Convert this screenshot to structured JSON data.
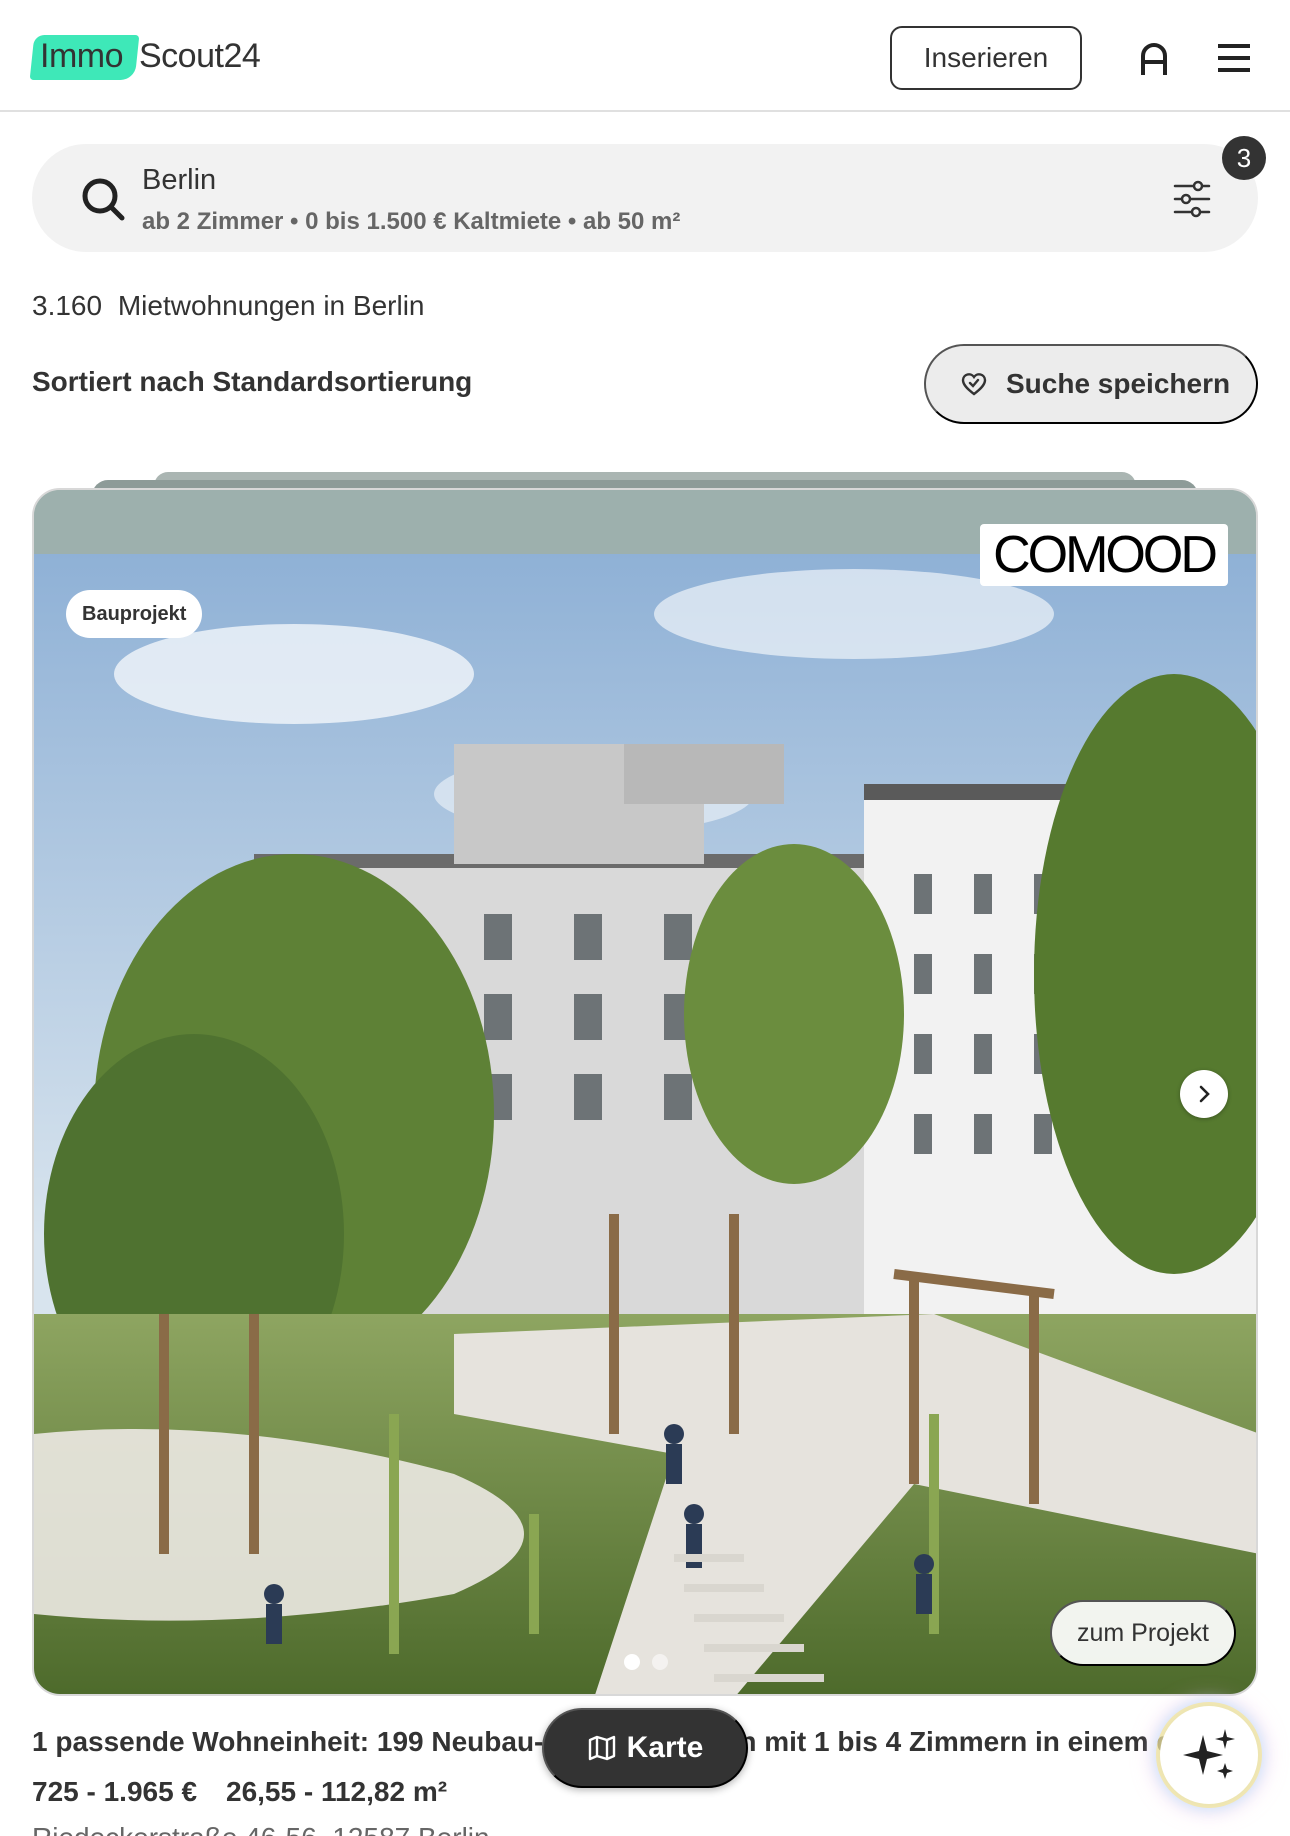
{
  "header": {
    "logo_part1": "Immo",
    "logo_part2": "Scout24",
    "insert_label": "Inserieren",
    "icons": [
      "user-icon",
      "menu-icon"
    ]
  },
  "search": {
    "location": "Berlin",
    "criteria": "ab 2 Zimmer • 0 bis 1.500 € Kaltmiete • ab 50 m²",
    "filter_count": "3",
    "icons": [
      "search-icon",
      "filter-icon"
    ]
  },
  "results": {
    "count": "3.160",
    "label": "Mietwohnungen in Berlin",
    "sort_label": "Sortiert nach Standardsortierung",
    "save_search_label": "Suche speichern"
  },
  "listing": {
    "badge": "Bauprojekt",
    "brand": "COMOOD",
    "project_button": "zum Projekt",
    "slide_count": 2,
    "active_slide": 1,
    "title": "1 passende Wohneinheit: 199 Neubau-Mietwohnungen mit 1 bis 4 Zimmern in einem der",
    "price": "725 - 1.965 €",
    "area": "26,55 - 112,82 m²",
    "address": "Riedeckerstraße 46-56, 12587 Berlin"
  },
  "floating": {
    "map_label": "Karte",
    "ai_icon": "sparkles-icon"
  },
  "colors": {
    "brand_accent": "#3ee8b8",
    "text": "#333333",
    "muted_text": "#666666",
    "search_bg": "#f2f2f2"
  }
}
